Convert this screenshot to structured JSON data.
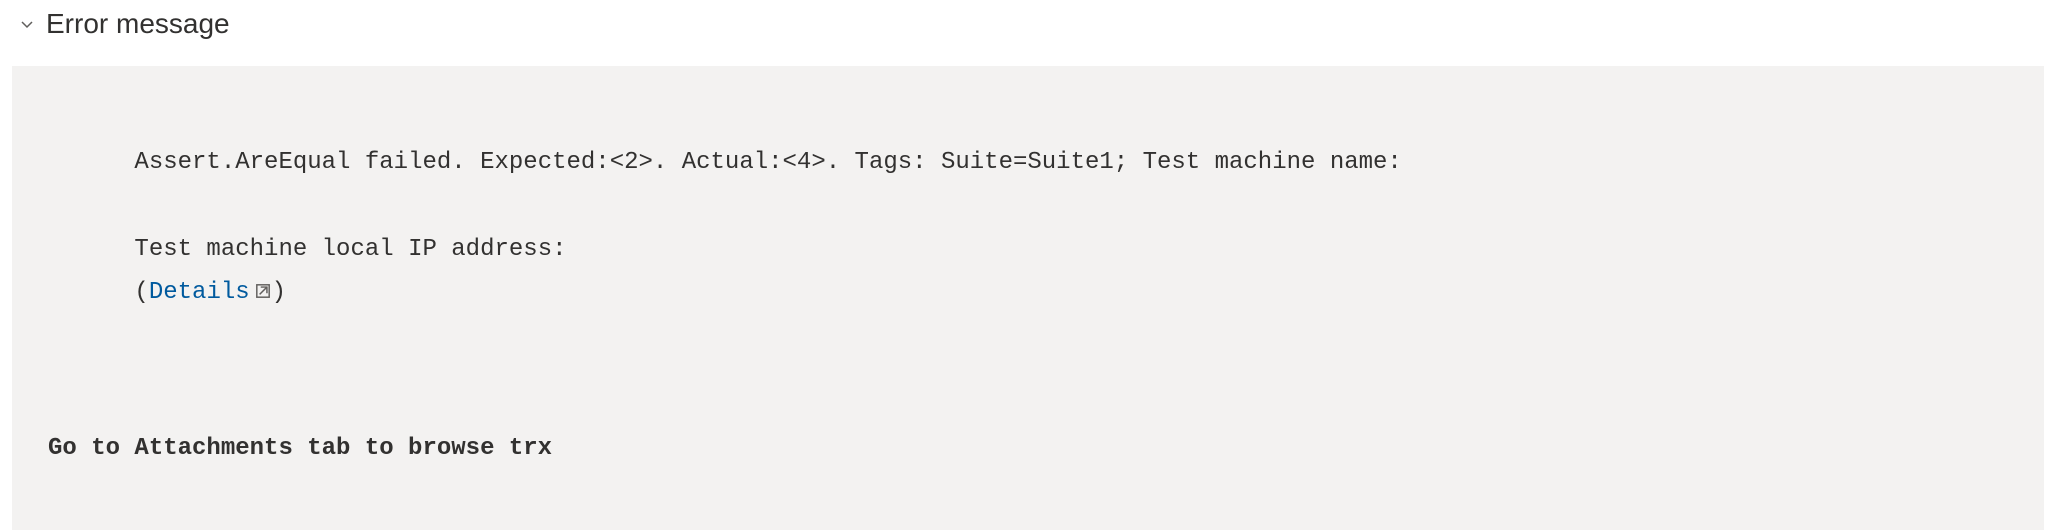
{
  "section": {
    "title": "Error message"
  },
  "error": {
    "line1": "Assert.AreEqual failed. Expected:<2>. Actual:<4>. Tags: Suite=Suite1; Test machine name:",
    "line2_prefix": "Test machine local IP address: ",
    "details_open": "(",
    "details_label": "Details",
    "details_close": ")"
  },
  "hint": {
    "text": "Go to Attachments tab to browse trx"
  }
}
